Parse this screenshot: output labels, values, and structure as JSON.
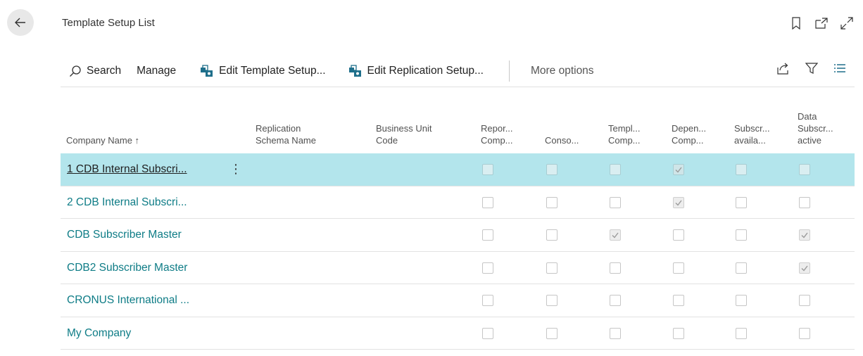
{
  "header": {
    "title": "Template Setup List"
  },
  "actions": {
    "search": "Search",
    "manage": "Manage",
    "edit_template_setup": "Edit Template Setup...",
    "edit_replication_setup": "Edit Replication Setup...",
    "more_options": "More options"
  },
  "columns": {
    "company_name": "Company Name ↑",
    "replication_schema_name": "Replication\nSchema Name",
    "business_unit_code": "Business Unit\nCode",
    "reporting_company": "Repor...\nComp...",
    "consolidation": "Conso...",
    "template_company": "Templ...\nComp...",
    "dependent_company": "Depen...\nComp...",
    "subscription_available": "Subscr...\navaila...",
    "data_subscription_active": "Data\nSubscr...\nactive"
  },
  "rows": [
    {
      "company_name": "1 CDB Internal Subscri...",
      "flags": [
        false,
        false,
        false,
        true,
        false,
        false
      ]
    },
    {
      "company_name": "2 CDB Internal Subscri...",
      "flags": [
        false,
        false,
        false,
        true,
        false,
        false
      ]
    },
    {
      "company_name": "CDB Subscriber Master",
      "flags": [
        false,
        false,
        true,
        false,
        false,
        true
      ]
    },
    {
      "company_name": "CDB2 Subscriber Master",
      "flags": [
        false,
        false,
        false,
        false,
        false,
        true
      ]
    },
    {
      "company_name": "CRONUS International ...",
      "flags": [
        false,
        false,
        false,
        false,
        false,
        false
      ]
    },
    {
      "company_name": "My Company",
      "flags": [
        false,
        false,
        false,
        false,
        false,
        false
      ]
    }
  ],
  "selected_row_index": 0,
  "icons": {
    "back": "arrow-left-icon",
    "bookmark": "bookmark-icon",
    "open_new_window": "open-new-window-icon",
    "expand": "expand-icon",
    "search": "search-icon",
    "edit": "edit-setup-icon",
    "share": "share-icon",
    "filter": "filter-icon",
    "list": "list-view-icon",
    "row_menu": "more-vertical-icon"
  },
  "colors": {
    "accent": "#0e7c86",
    "selected_row": "#b3e5ec",
    "text": "#212121"
  }
}
